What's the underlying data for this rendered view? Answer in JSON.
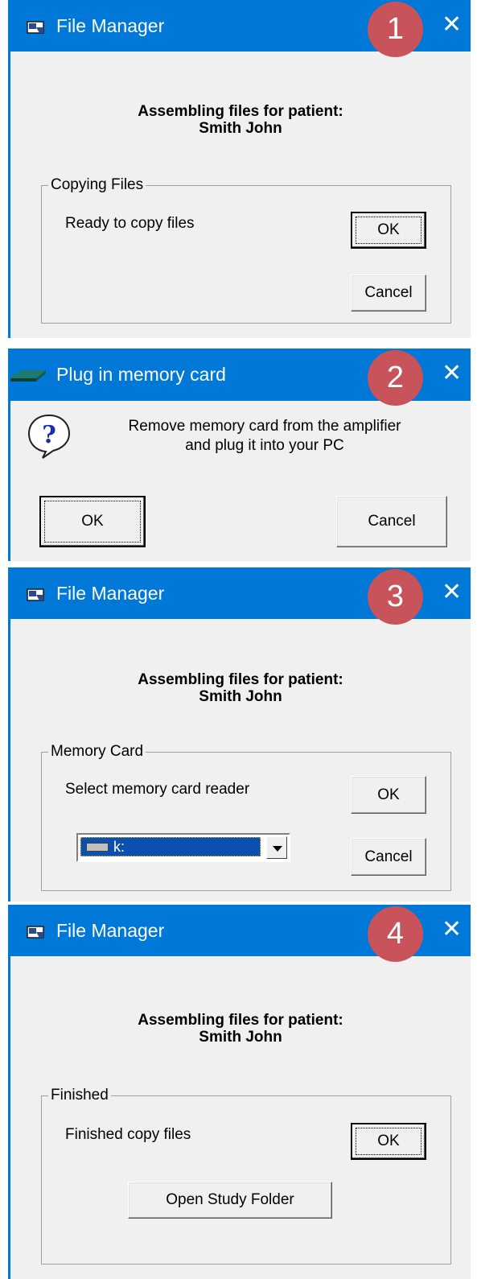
{
  "dialogs": [
    {
      "title": "File Manager",
      "step": "1",
      "close": "✕",
      "heading_line1": "Assembling files for patient:",
      "heading_line2": "Smith John",
      "group_title": "Copying Files",
      "status": "Ready to copy files",
      "ok_label": "OK",
      "cancel_label": "Cancel"
    },
    {
      "title": "Plug in memory card",
      "step": "2",
      "close": "✕",
      "message_line1": "Remove memory card from the amplifier",
      "message_line2": "and plug it into your PC",
      "ok_label": "OK",
      "cancel_label": "Cancel"
    },
    {
      "title": "File Manager",
      "step": "3",
      "close": "✕",
      "heading_line1": "Assembling files for patient:",
      "heading_line2": "Smith John",
      "group_title": "Memory Card",
      "prompt": "Select memory card reader",
      "drive_value": "k:",
      "ok_label": "OK",
      "cancel_label": "Cancel"
    },
    {
      "title": "File Manager",
      "step": "4",
      "close": "✕",
      "heading_line1": "Assembling files for patient:",
      "heading_line2": "Smith John",
      "group_title": "Finished",
      "status": "Finished copy files",
      "ok_label": "OK",
      "open_folder_label": "Open Study Folder"
    }
  ],
  "colors": {
    "titlebar": "#0078d7",
    "badge": "#c8535b",
    "dialog_bg": "#f0f0f0",
    "selection": "#0a50b0"
  },
  "icons": {
    "title_app": "file-manager-app-icon",
    "title_card": "memory-card-icon",
    "question": "question-icon",
    "drive": "drive-icon"
  }
}
